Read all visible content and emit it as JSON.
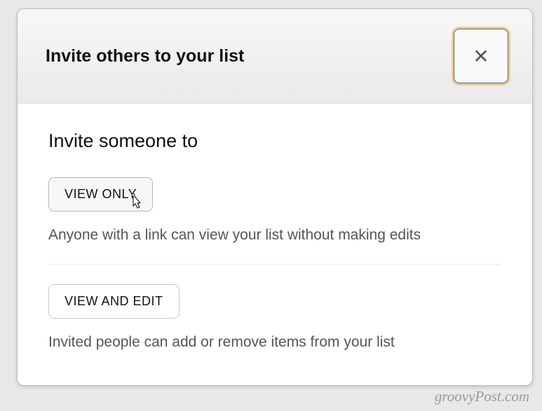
{
  "modal": {
    "title": "Invite others to your list",
    "subtitle": "Invite someone to",
    "close_label": "✕",
    "options": [
      {
        "button_label": "VIEW ONLY",
        "description": "Anyone with a link can view your list without making edits"
      },
      {
        "button_label": "VIEW AND EDIT",
        "description": "Invited people can add or remove items from your list"
      }
    ]
  },
  "watermark": "groovyPost.com"
}
